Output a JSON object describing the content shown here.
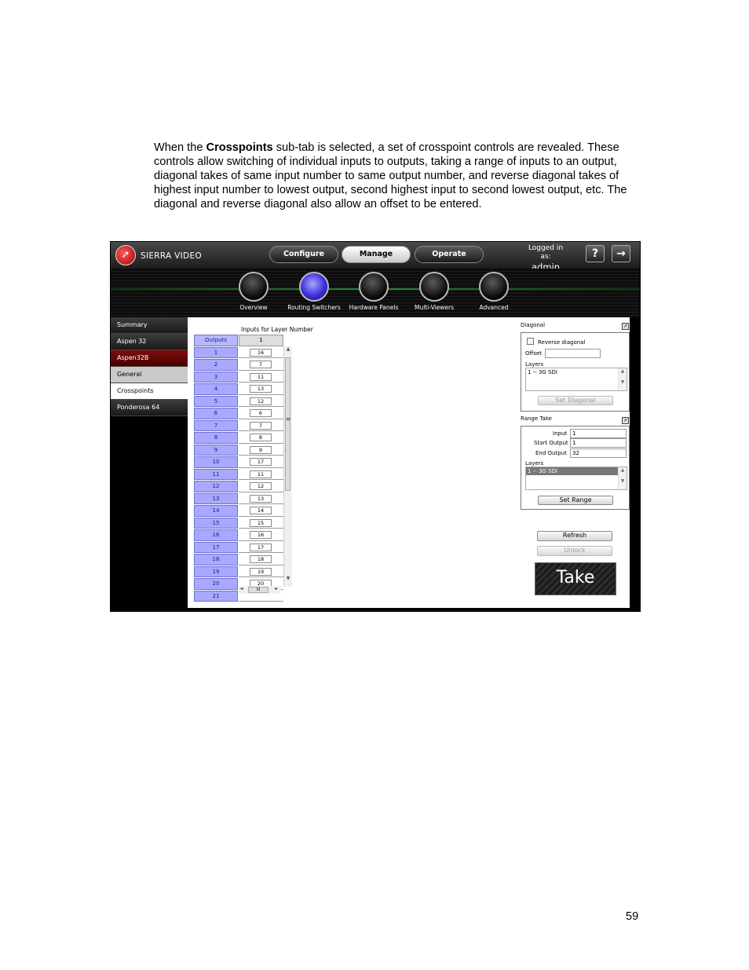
{
  "document": {
    "paragraph_pre": "When the ",
    "paragraph_bold": "Crosspoints",
    "paragraph_post": " sub-tab is selected, a set of crosspoint controls are revealed. These controls allow switching of individual inputs to outputs, taking a range of inputs to an output, diagonal takes of same input number to same output number, and reverse diagonal takes of highest input number to lowest output, second highest input to second lowest output, etc. The diagonal and reverse diagonal also allow an offset to be entered.",
    "page_number": "59"
  },
  "app": {
    "logo_text": "SIERRA VIDEO",
    "tabs": [
      {
        "label": "Configure"
      },
      {
        "label": "Manage"
      },
      {
        "label": "Operate"
      }
    ],
    "logged_in_label": "Logged in as:",
    "username": "admin",
    "help_glyph": "?",
    "logout_glyph": "→",
    "nav": [
      {
        "label": "Overview"
      },
      {
        "label": "Routing Switchers"
      },
      {
        "label": "Hardware Panels"
      },
      {
        "label": "Multi-Viewers"
      },
      {
        "label": "Advanced"
      }
    ],
    "sidebar": [
      {
        "label": "Summary"
      },
      {
        "label": "Aspen 32"
      },
      {
        "label": "Aspen32B"
      },
      {
        "label": "General"
      },
      {
        "label": "Crosspoints"
      },
      {
        "label": "Ponderosa 64"
      }
    ],
    "grid": {
      "title": "Inputs for Layer Number",
      "outputs_header": "Outputs",
      "layer_header": "1",
      "rows": [
        {
          "output": "1",
          "input": "16"
        },
        {
          "output": "2",
          "input": "7"
        },
        {
          "output": "3",
          "input": "11"
        },
        {
          "output": "4",
          "input": "13"
        },
        {
          "output": "5",
          "input": "12"
        },
        {
          "output": "6",
          "input": "6"
        },
        {
          "output": "7",
          "input": "7"
        },
        {
          "output": "8",
          "input": "8"
        },
        {
          "output": "9",
          "input": "9"
        },
        {
          "output": "10",
          "input": "17"
        },
        {
          "output": "11",
          "input": "11"
        },
        {
          "output": "12",
          "input": "12"
        },
        {
          "output": "13",
          "input": "13"
        },
        {
          "output": "14",
          "input": "14"
        },
        {
          "output": "15",
          "input": "15"
        },
        {
          "output": "16",
          "input": "16"
        },
        {
          "output": "17",
          "input": "17"
        },
        {
          "output": "18",
          "input": "18"
        },
        {
          "output": "19",
          "input": "19"
        },
        {
          "output": "20",
          "input": "20"
        },
        {
          "output": "21",
          "input": ""
        }
      ],
      "hscroll_thumb": "III",
      "scroll_up": "▲",
      "scroll_down": "▼",
      "scroll_left": "◄",
      "scroll_right": "►",
      "scroll_grip": "≡"
    },
    "diagonal": {
      "title": "Diagonal",
      "reverse_label": "Reverse diagonal",
      "offset_label": "Offset",
      "offset_value": "",
      "layers_label": "Layers",
      "layer_item": "1 -- 3G SDI",
      "button": "Set Diagonal"
    },
    "range_take": {
      "title": "Range Take",
      "input_label": "Input",
      "input_value": "1",
      "start_label": "Start Output",
      "start_value": "1",
      "end_label": "End Output",
      "end_value": "32",
      "layers_label": "Layers",
      "layer_item": "1 -- 3G SDI",
      "button": "Set Range"
    },
    "refresh_button": "Refresh",
    "unlock_button": "Unlock",
    "take_button": "Take"
  }
}
